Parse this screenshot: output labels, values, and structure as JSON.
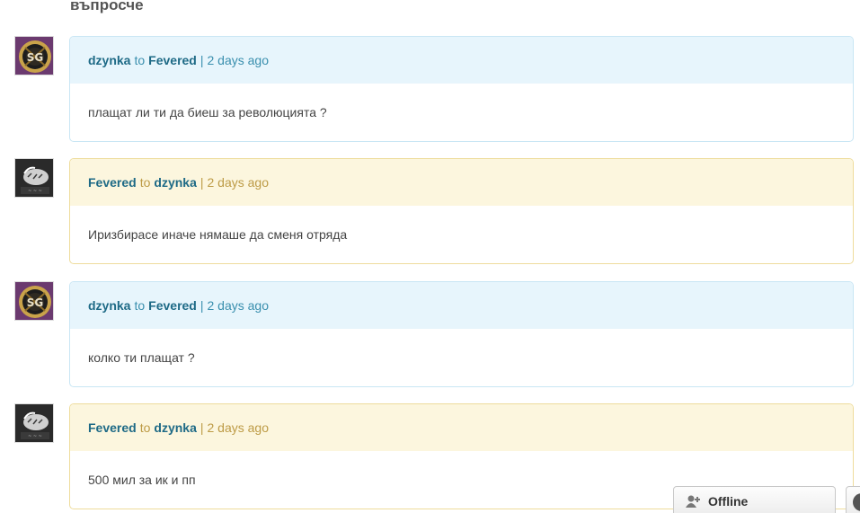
{
  "page": {
    "title": "въпросче"
  },
  "colors": {
    "link": "#1e6a86",
    "blue_header": "#e7f5fc",
    "blue_border": "#c9e6f4",
    "yellow_header": "#fcf6de",
    "yellow_border": "#eedc9c"
  },
  "messages": [
    {
      "from": "dzynka",
      "to_word": "to",
      "to": "Fevered",
      "sep": "|",
      "time": "2 days ago",
      "text": "плащат ли ти да биеш за революцията ?",
      "style": "blue",
      "avatar": "sg-emblem-avatar"
    },
    {
      "from": "Fevered",
      "to_word": "to",
      "to": "dzynka",
      "sep": "|",
      "time": "2 days ago",
      "text": "Иризбирасе иначе нямаше да сменя отряда",
      "style": "yellow",
      "avatar": "tiger-avatar"
    },
    {
      "from": "dzynka",
      "to_word": "to",
      "to": "Fevered",
      "sep": "|",
      "time": "2 days ago",
      "text": "колко ти плащат ?",
      "style": "blue",
      "avatar": "sg-emblem-avatar"
    },
    {
      "from": "Fevered",
      "to_word": "to",
      "to": "dzynka",
      "sep": "|",
      "time": "2 days ago",
      "text": "500 мил за ик и пп",
      "style": "yellow",
      "avatar": "tiger-avatar"
    }
  ],
  "chat": {
    "status": "Offline",
    "icon": "user-add-icon"
  }
}
